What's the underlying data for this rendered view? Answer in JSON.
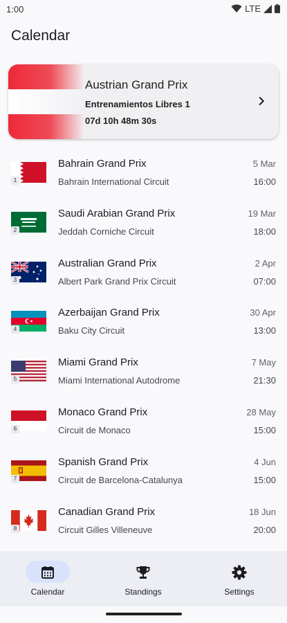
{
  "status_bar": {
    "time": "1:00",
    "network": "LTE"
  },
  "page_title": "Calendar",
  "next_race": {
    "name": "Austrian Grand Prix",
    "session": "Entrenamientos Libres 1",
    "countdown": "07d 10h 48m 30s",
    "flag_colors": [
      "#ED2939",
      "#FFFFFF",
      "#ED2939"
    ]
  },
  "races": [
    {
      "round": "1",
      "name": "Bahrain Grand Prix",
      "circuit": "Bahrain International Circuit",
      "date": "5 Mar",
      "time": "16:00",
      "flag": "bahrain"
    },
    {
      "round": "2",
      "name": "Saudi Arabian Grand Prix",
      "circuit": "Jeddah Corniche Circuit",
      "date": "19 Mar",
      "time": "18:00",
      "flag": "saudi-arabia"
    },
    {
      "round": "3",
      "name": "Australian Grand Prix",
      "circuit": "Albert Park Grand Prix Circuit",
      "date": "2 Apr",
      "time": "07:00",
      "flag": "australia"
    },
    {
      "round": "4",
      "name": "Azerbaijan Grand Prix",
      "circuit": "Baku City Circuit",
      "date": "30 Apr",
      "time": "13:00",
      "flag": "azerbaijan"
    },
    {
      "round": "5",
      "name": "Miami Grand Prix",
      "circuit": "Miami International Autodrome",
      "date": "7 May",
      "time": "21:30",
      "flag": "usa"
    },
    {
      "round": "6",
      "name": "Monaco Grand Prix",
      "circuit": "Circuit de Monaco",
      "date": "28 May",
      "time": "15:00",
      "flag": "monaco"
    },
    {
      "round": "7",
      "name": "Spanish Grand Prix",
      "circuit": "Circuit de Barcelona-Catalunya",
      "date": "4 Jun",
      "time": "15:00",
      "flag": "spain"
    },
    {
      "round": "8",
      "name": "Canadian Grand Prix",
      "circuit": "Circuit Gilles Villeneuve",
      "date": "18 Jun",
      "time": "20:00",
      "flag": "canada"
    }
  ],
  "bottom_nav": [
    {
      "label": "Calendar",
      "icon": "calendar-icon",
      "active": true
    },
    {
      "label": "Standings",
      "icon": "trophy-icon",
      "active": false
    },
    {
      "label": "Settings",
      "icon": "gear-icon",
      "active": false
    }
  ]
}
